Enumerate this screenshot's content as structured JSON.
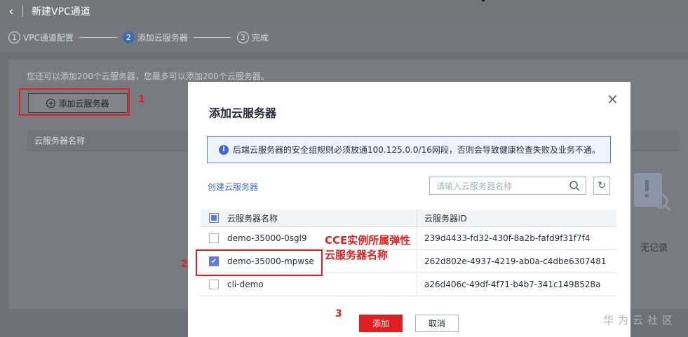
{
  "header": {
    "title": "新建VPC通道"
  },
  "steps": [
    {
      "num": "1",
      "label": "VPC通道配置"
    },
    {
      "num": "2",
      "label": "添加云服务器"
    },
    {
      "num": "3",
      "label": "完成"
    }
  ],
  "background": {
    "info_line": "您还可以添加200个云服务器，您最多可以添加200个云服务器。",
    "add_button_label": "添加云服务器",
    "table_header": "云服务器名称",
    "empty_text": "无记录"
  },
  "annotations": {
    "label_1": "1",
    "label_2": "2",
    "label_3": "3",
    "note_line1": "CCE实例所属弹性",
    "note_line2": "云服务器名称",
    "highlight_color": "#e02020"
  },
  "modal": {
    "title": "添加云服务器",
    "notice": "后端云服务器的安全组规则必须放通100.125.0.0/16网段，否则会导致健康检查失败及业务不通。",
    "create_link": "创建云服务器",
    "search_placeholder": "请输入云服务器名称",
    "columns": [
      "云服务器名称",
      "云服务器ID"
    ],
    "rows": [
      {
        "name": "demo-35000-0sgl9",
        "id": "239d4433-fd32-430f-8a2b-fafd9f31f7f4",
        "checked": false
      },
      {
        "name": "demo-35000-mpwse",
        "id": "262d802e-4937-4219-ab0a-c4dbe6307481",
        "checked": true
      },
      {
        "name": "cli-demo",
        "id": "a26d406c-49df-4f71-b4b7-341c1498528a",
        "checked": false
      }
    ],
    "confirm_label": "添加",
    "cancel_label": "取消",
    "accent_color": "#5e7ce0"
  },
  "watermark": "华为云社区"
}
